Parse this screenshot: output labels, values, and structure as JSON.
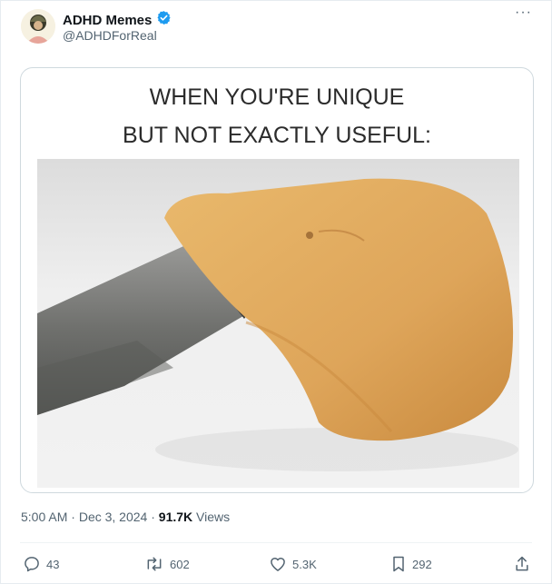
{
  "author": {
    "display_name": "ADHD Memes",
    "handle": "@ADHDForReal",
    "verified_badge_icon": "verified-check-icon"
  },
  "menu": {
    "more_label": "···"
  },
  "meme": {
    "caption_line1": "WHEN YOU'RE UNIQUE",
    "caption_line2": "BUT NOT EXACTLY USEFUL:"
  },
  "timestamp": {
    "time": "5:00 AM",
    "separator1": "·",
    "date": "Dec 3, 2024",
    "separator2": "·",
    "views_count": "91.7K",
    "views_label": "Views"
  },
  "actions": {
    "replies": "43",
    "reposts": "602",
    "likes": "5.3K",
    "bookmarks": "292"
  },
  "colors": {
    "muted_text": "#536471",
    "verified_blue": "#1d9bf0"
  }
}
